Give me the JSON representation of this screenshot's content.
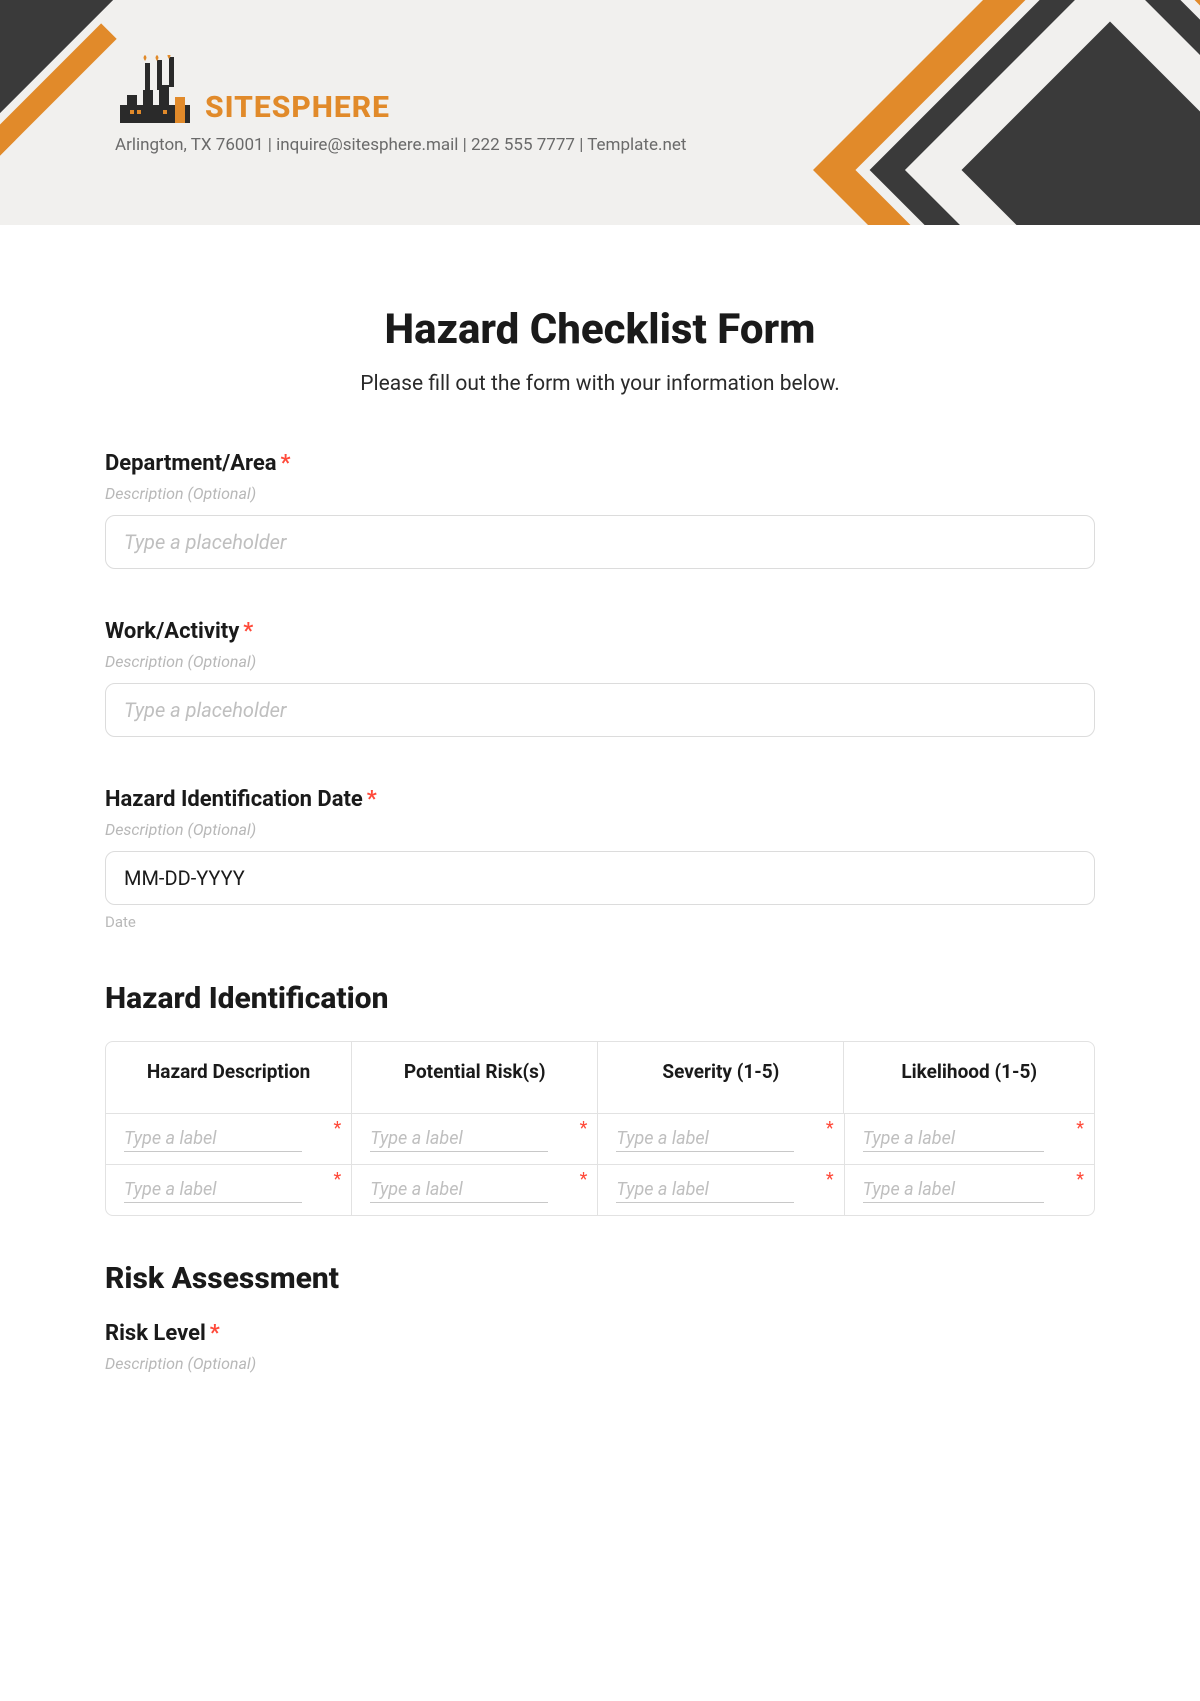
{
  "header": {
    "brand": "SITESPHERE",
    "contact": "Arlington, TX 76001 | inquire@sitesphere.mail | 222 555 7777 | Template.net"
  },
  "page": {
    "title": "Hazard Checklist Form",
    "subtitle": "Please fill out the form with your information below."
  },
  "fields": {
    "department": {
      "label": "Department/Area",
      "required": "*",
      "desc": "Description (Optional)",
      "placeholder": "Type a placeholder"
    },
    "activity": {
      "label": "Work/Activity",
      "required": "*",
      "desc": "Description (Optional)",
      "placeholder": "Type a placeholder"
    },
    "date": {
      "label": "Hazard Identification Date",
      "required": "*",
      "desc": "Description (Optional)",
      "value": "MM-DD-YYYY",
      "sublabel": "Date"
    }
  },
  "sections": {
    "hazard_id": "Hazard Identification",
    "risk_assess": "Risk Assessment"
  },
  "table": {
    "headers": [
      "Hazard Description",
      "Potential Risk(s)",
      "Severity (1-5)",
      "Likelihood (1-5)"
    ],
    "cell_placeholder": "Type a label",
    "cell_required": "*",
    "rows": 2
  },
  "risk": {
    "label": "Risk Level",
    "required": "*",
    "desc": "Description (Optional)"
  }
}
